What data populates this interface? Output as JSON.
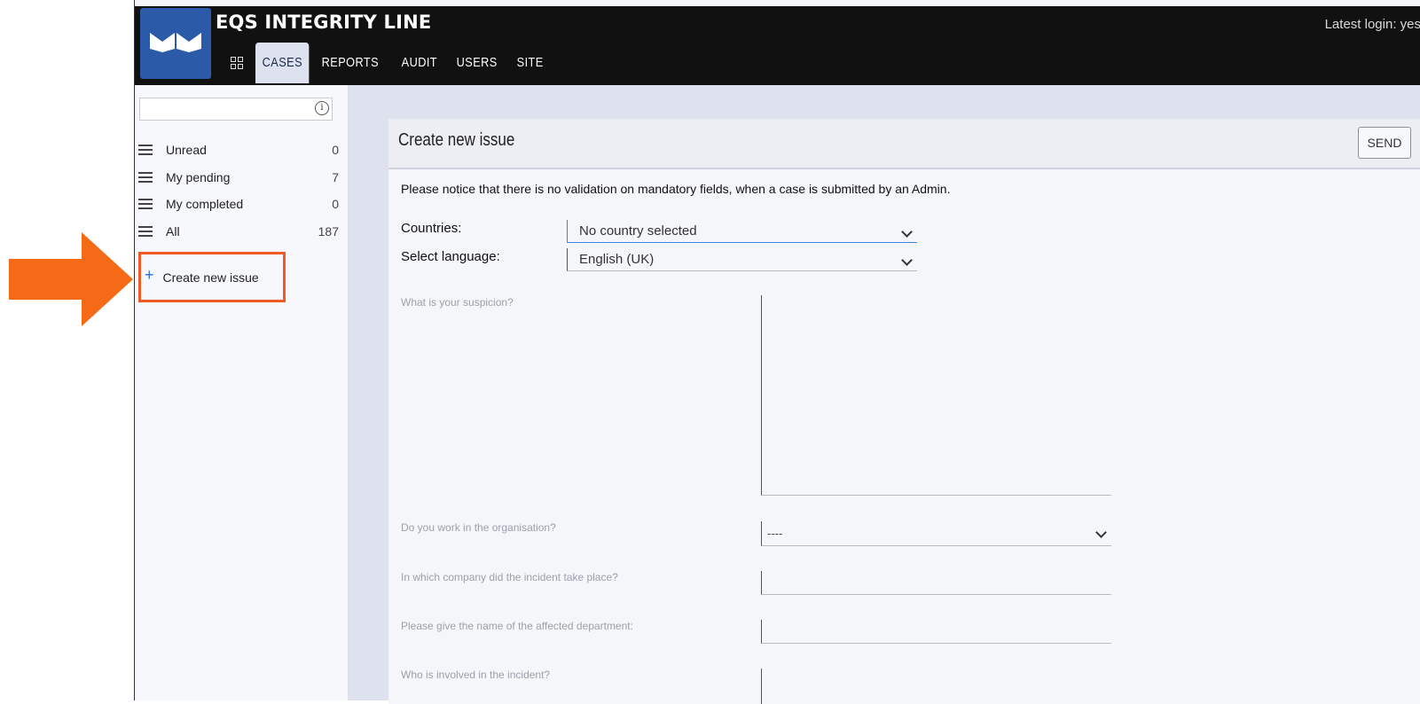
{
  "header": {
    "brand": "EQS INTEGRITY LINE",
    "latest_login": "Latest login: yes",
    "nav": [
      {
        "label": "CASES"
      },
      {
        "label": "REPORTS"
      },
      {
        "label": "AUDIT"
      },
      {
        "label": "USERS"
      },
      {
        "label": "SITE"
      }
    ]
  },
  "sidebar": {
    "search_value": "",
    "filters": [
      {
        "label": "Unread",
        "count": "0"
      },
      {
        "label": "My pending",
        "count": "7"
      },
      {
        "label": "My completed",
        "count": "0"
      },
      {
        "label": "All",
        "count": "187"
      }
    ],
    "create_label": "Create new issue"
  },
  "main": {
    "title": "Create new issue",
    "send_label": "SEND",
    "notice": "Please notice that there is no validation on mandatory fields, when a case is submitted by an Admin.",
    "countries_label": "Countries:",
    "countries_value": "No country selected",
    "language_label": "Select language:",
    "language_value": "English (UK)",
    "questions": [
      {
        "label": "What is your suspicion?"
      },
      {
        "label": "Do you work in the organisation?",
        "value": "----"
      },
      {
        "label": "In which company did the incident take place?"
      },
      {
        "label": "Please give the name of the affected department:"
      },
      {
        "label": "Who is involved in the incident?"
      }
    ]
  },
  "colors": {
    "accent_orange": "#f05a24",
    "logo_blue": "#2b5aa8",
    "header_bg": "#111111"
  }
}
